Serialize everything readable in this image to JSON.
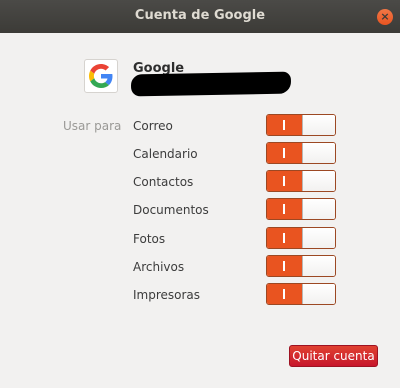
{
  "window": {
    "title": "Cuenta de Google",
    "close_glyph": "×"
  },
  "account": {
    "provider": "Google",
    "logo_icon": "google-g-icon"
  },
  "usage": {
    "label": "Usar para",
    "services": [
      {
        "label": "Correo",
        "enabled": true
      },
      {
        "label": "Calendario",
        "enabled": true
      },
      {
        "label": "Contactos",
        "enabled": true
      },
      {
        "label": "Documentos",
        "enabled": true
      },
      {
        "label": "Fotos",
        "enabled": true
      },
      {
        "label": "Archivos",
        "enabled": true
      },
      {
        "label": "Impresoras",
        "enabled": true
      }
    ]
  },
  "actions": {
    "remove_label": "Quitar cuenta"
  },
  "colors": {
    "accent": "#e95420",
    "danger": "#c7162b",
    "titlebar": "#3c3b37"
  }
}
